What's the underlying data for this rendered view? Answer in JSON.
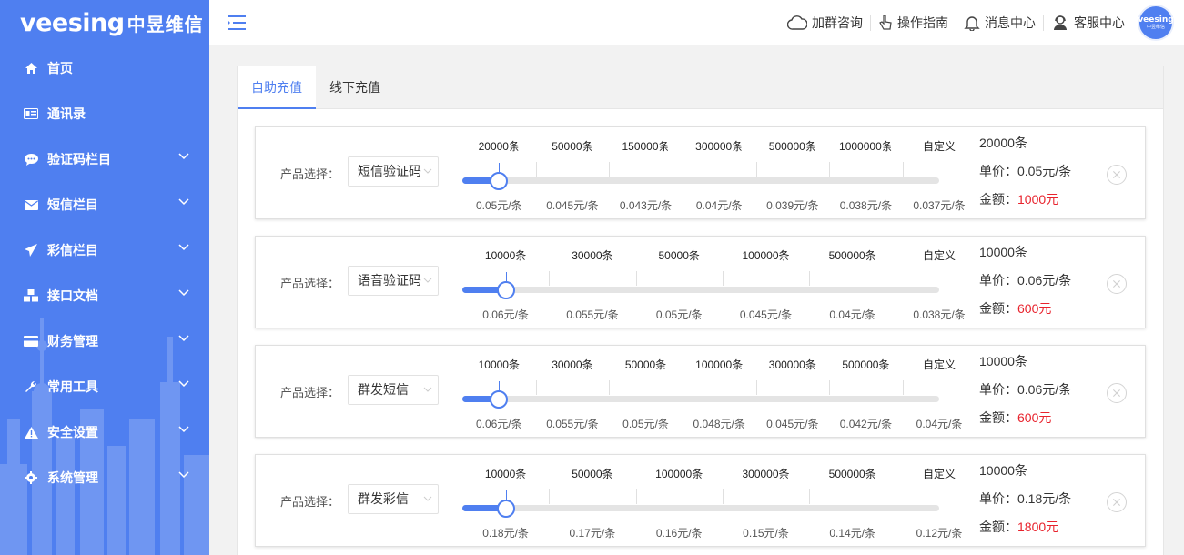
{
  "brand": {
    "logo_latin": "veesing",
    "logo_cn": "中昱维信"
  },
  "sidebar": {
    "items": [
      {
        "label": "首页",
        "icon": "home-icon",
        "has_children": false
      },
      {
        "label": "通讯录",
        "icon": "contacts-icon",
        "has_children": false
      },
      {
        "label": "验证码栏目",
        "icon": "chat-bubble-icon",
        "has_children": true
      },
      {
        "label": "短信栏目",
        "icon": "envelope-icon",
        "has_children": true
      },
      {
        "label": "彩信栏目",
        "icon": "send-icon",
        "has_children": true
      },
      {
        "label": "接口文档",
        "icon": "cubes-icon",
        "has_children": true
      },
      {
        "label": "财务管理",
        "icon": "credit-card-icon",
        "has_children": true
      },
      {
        "label": "常用工具",
        "icon": "wrench-icon",
        "has_children": true
      },
      {
        "label": "安全设置",
        "icon": "warning-icon",
        "has_children": true
      },
      {
        "label": "系统管理",
        "icon": "gear-icon",
        "has_children": true
      }
    ]
  },
  "header": {
    "nav": [
      {
        "label": "加群咨询",
        "icon": "cloud-group-icon"
      },
      {
        "label": "操作指南",
        "icon": "pointer-hand-icon"
      },
      {
        "label": "消息中心",
        "icon": "bell-icon"
      },
      {
        "label": "客服中心",
        "icon": "support-agent-icon"
      }
    ],
    "avatar": {
      "logo_latin": "veesing",
      "logo_cn": "中昱维信"
    }
  },
  "tabs": [
    {
      "label": "自助充值",
      "active": true
    },
    {
      "label": "线下充值",
      "active": false
    }
  ],
  "product_label": "产品选择：",
  "cards": [
    {
      "product": "短信验证码",
      "quantities": [
        "20000条",
        "50000条",
        "150000条",
        "300000条",
        "500000条",
        "1000000条",
        "自定义"
      ],
      "prices": [
        "0.05元/条",
        "0.045元/条",
        "0.043元/条",
        "0.04元/条",
        "0.039元/条",
        "0.038元/条",
        "0.037元/条"
      ],
      "selected_index": 0,
      "count_text": "20000条",
      "unit_price_text": "单价：0.05元/条",
      "total_label": "金额：",
      "total_value": "1000元"
    },
    {
      "product": "语音验证码",
      "quantities": [
        "10000条",
        "30000条",
        "50000条",
        "100000条",
        "500000条",
        "自定义"
      ],
      "prices": [
        "0.06元/条",
        "0.055元/条",
        "0.05元/条",
        "0.045元/条",
        "0.04元/条",
        "0.038元/条"
      ],
      "selected_index": 0,
      "count_text": "10000条",
      "unit_price_text": "单价：0.06元/条",
      "total_label": "金额：",
      "total_value": "600元"
    },
    {
      "product": "群发短信",
      "quantities": [
        "10000条",
        "30000条",
        "50000条",
        "100000条",
        "300000条",
        "500000条",
        "自定义"
      ],
      "prices": [
        "0.06元/条",
        "0.055元/条",
        "0.05元/条",
        "0.048元/条",
        "0.045元/条",
        "0.042元/条",
        "0.04元/条"
      ],
      "selected_index": 0,
      "count_text": "10000条",
      "unit_price_text": "单价：0.06元/条",
      "total_label": "金额：",
      "total_value": "600元"
    },
    {
      "product": "群发彩信",
      "quantities": [
        "10000条",
        "50000条",
        "100000条",
        "300000条",
        "500000条",
        "自定义"
      ],
      "prices": [
        "0.18元/条",
        "0.17元/条",
        "0.16元/条",
        "0.15元/条",
        "0.14元/条",
        "0.12元/条"
      ],
      "selected_index": 0,
      "count_text": "10000条",
      "unit_price_text": "单价：0.18元/条",
      "total_label": "金额：",
      "total_value": "1800元"
    }
  ],
  "colors": {
    "primary": "#4f7ff0",
    "amount": "#e8232d"
  }
}
